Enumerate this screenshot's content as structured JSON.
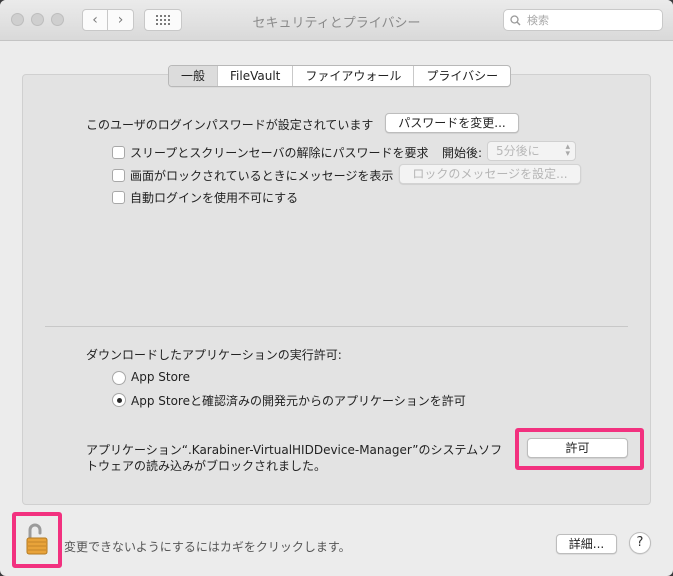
{
  "window": {
    "title": "セキュリティとプライバシー"
  },
  "toolbar": {
    "back_icon": "‹",
    "forward_icon": "›",
    "grid_icon": "grid-icon"
  },
  "search": {
    "placeholder": "検索"
  },
  "tabs": [
    {
      "label": "一般",
      "active": true
    },
    {
      "label": "FileVault",
      "active": false
    },
    {
      "label": "ファイアウォール",
      "active": false
    },
    {
      "label": "プライバシー",
      "active": false
    }
  ],
  "general": {
    "password_text": "このユーザのログインパスワードが設定されています",
    "change_password_button": "パスワードを変更...",
    "require_password_label": "スリープとスクリーンセーバの解除にパスワードを要求",
    "start_after_label": "開始後:",
    "start_after_value": "5分後に",
    "lock_message_label": "画面がロックされているときにメッセージを表示",
    "lock_message_button": "ロックのメッセージを設定...",
    "disable_autologin_label": "自動ログインを使用不可にする"
  },
  "downloads": {
    "heading": "ダウンロードしたアプリケーションの実行許可:",
    "option_app_store": "App Store",
    "option_app_store_identified": "App Storeと確認済みの開発元からのアプリケーションを許可",
    "blocked_line1": "アプリケーション“.Karabiner-VirtualHIDDevice-Manager”のシステムソフ",
    "blocked_line2": "トウェアの読み込みがブロックされました。",
    "allow_button": "許可"
  },
  "footer": {
    "lock_text": "変更できないようにするにはカギをクリックします。",
    "advanced_button": "詳細...",
    "help_button": "?"
  },
  "colors": {
    "highlight": "#f2317f",
    "lock_gold": "#e8a33a"
  }
}
